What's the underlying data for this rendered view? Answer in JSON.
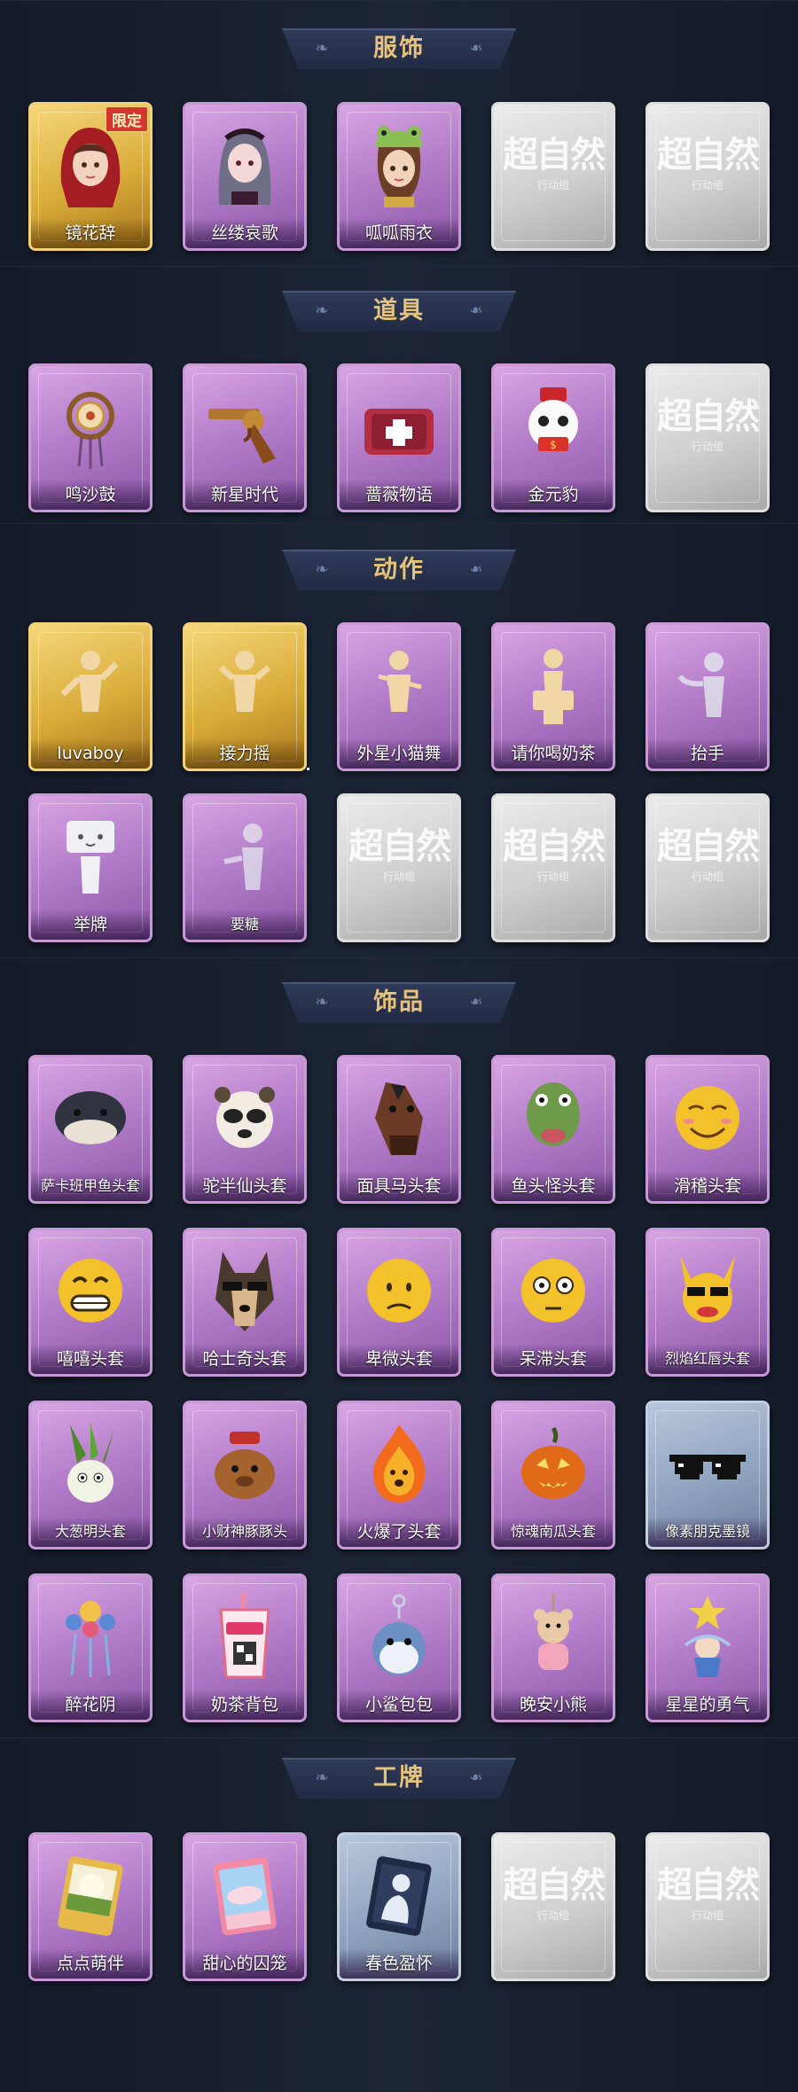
{
  "sections": [
    {
      "title": "服饰",
      "cards": [
        {
          "label": "镜花辞",
          "style": "gold",
          "badge": "限定",
          "icon": "portrait-red-hood-icon"
        },
        {
          "label": "丝缕哀歌",
          "style": "purple",
          "icon": "portrait-lace-doll-icon"
        },
        {
          "label": "呱呱雨衣",
          "style": "purple",
          "icon": "portrait-frog-hat-icon"
        },
        {
          "label": "",
          "style": "grey",
          "watermark": "超自然",
          "watermark_sub": "行动组",
          "icon": "locked-card-icon"
        },
        {
          "label": "",
          "style": "grey",
          "watermark": "超自然",
          "watermark_sub": "行动组",
          "icon": "locked-card-icon"
        }
      ]
    },
    {
      "title": "道具",
      "cards": [
        {
          "label": "鸣沙鼓",
          "style": "purple",
          "icon": "dreamcatcher-drum-icon"
        },
        {
          "label": "新星时代",
          "style": "purple",
          "icon": "revolver-icon"
        },
        {
          "label": "蔷薇物语",
          "style": "purple",
          "icon": "medkit-icon"
        },
        {
          "label": "金元豹",
          "style": "purple",
          "icon": "lucky-panda-icon"
        },
        {
          "label": "",
          "style": "grey",
          "watermark": "超自然",
          "watermark_sub": "行动组",
          "icon": "locked-card-icon"
        }
      ]
    },
    {
      "title": "动作",
      "cards": [
        {
          "label": "luvaboy",
          "style": "gold",
          "icon": "dance-pose-icon"
        },
        {
          "label": "接力摇",
          "style": "gold",
          "icon": "shake-pose-icon"
        },
        {
          "label": "外星小猫舞",
          "style": "purple",
          "icon": "cat-dance-pose-icon"
        },
        {
          "label": "请你喝奶茶",
          "style": "purple",
          "icon": "serve-tea-pose-icon"
        },
        {
          "label": "抬手",
          "style": "purple",
          "icon": "raise-hand-pose-icon"
        },
        {
          "label": "举牌",
          "style": "purple",
          "icon": "hold-sign-pose-icon"
        },
        {
          "label": "要糖",
          "style": "purple",
          "icon": "ask-candy-pose-icon"
        },
        {
          "label": "",
          "style": "grey",
          "watermark": "超自然",
          "watermark_sub": "行动组",
          "icon": "locked-card-icon"
        },
        {
          "label": "",
          "style": "grey",
          "watermark": "超自然",
          "watermark_sub": "行动组",
          "icon": "locked-card-icon"
        },
        {
          "label": "",
          "style": "grey",
          "watermark": "超自然",
          "watermark_sub": "行动组",
          "icon": "locked-card-icon"
        }
      ]
    },
    {
      "title": "饰品",
      "cards": [
        {
          "label": "萨卡班甲鱼头套",
          "style": "purple",
          "icon": "fish-head-icon"
        },
        {
          "label": "驼半仙头套",
          "style": "purple",
          "icon": "alpaca-sunglasses-icon"
        },
        {
          "label": "面具马头套",
          "style": "purple",
          "icon": "horse-mask-icon"
        },
        {
          "label": "鱼头怪头套",
          "style": "purple",
          "icon": "fish-monster-icon"
        },
        {
          "label": "滑稽头套",
          "style": "purple",
          "icon": "funny-face-icon"
        },
        {
          "label": "嘻嘻头套",
          "style": "purple",
          "icon": "grin-face-icon"
        },
        {
          "label": "哈士奇头套",
          "style": "purple",
          "icon": "husky-sunglasses-icon"
        },
        {
          "label": "卑微头套",
          "style": "purple",
          "icon": "sad-face-icon"
        },
        {
          "label": "呆滞头套",
          "style": "purple",
          "icon": "stare-face-icon"
        },
        {
          "label": "烈焰红唇头套",
          "style": "purple",
          "icon": "yellow-mouse-icon"
        },
        {
          "label": "大葱明头套",
          "style": "purple",
          "icon": "green-onion-icon"
        },
        {
          "label": "小财神豚豚头",
          "style": "purple",
          "icon": "capybara-icon"
        },
        {
          "label": "火爆了头套",
          "style": "purple",
          "icon": "fire-face-icon"
        },
        {
          "label": "惊魂南瓜头套",
          "style": "purple",
          "icon": "pumpkin-icon"
        },
        {
          "label": "像素朋克墨镜",
          "style": "blue",
          "icon": "pixel-sunglasses-icon"
        },
        {
          "label": "醉花阴",
          "style": "purple",
          "icon": "flower-crown-icon"
        },
        {
          "label": "奶茶背包",
          "style": "purple",
          "icon": "milk-tea-bag-icon"
        },
        {
          "label": "小鲨包包",
          "style": "purple",
          "icon": "shark-bag-icon"
        },
        {
          "label": "晚安小熊",
          "style": "purple",
          "icon": "teddy-bear-icon"
        },
        {
          "label": "星星的勇气",
          "style": "purple",
          "icon": "star-charm-icon"
        }
      ]
    },
    {
      "title": "工牌",
      "cards": [
        {
          "label": "点点萌伴",
          "style": "purple",
          "icon": "badge-green-icon"
        },
        {
          "label": "甜心的囚笼",
          "style": "purple",
          "icon": "badge-pink-icon"
        },
        {
          "label": "春色盈怀",
          "style": "blue",
          "icon": "badge-silhouette-icon"
        },
        {
          "label": "",
          "style": "grey",
          "watermark": "超自然",
          "watermark_sub": "行动组",
          "icon": "locked-card-icon"
        },
        {
          "label": "",
          "style": "grey",
          "watermark": "超自然",
          "watermark_sub": "行动组",
          "icon": "locked-card-icon"
        }
      ]
    }
  ],
  "colors": {
    "background": "#101521",
    "title_gold": "#e6c37a",
    "card_purple": "#b67fcb",
    "card_gold": "#d9ac3a",
    "card_grey": "#cfcfcf",
    "card_blue": "#8fa3bf"
  }
}
